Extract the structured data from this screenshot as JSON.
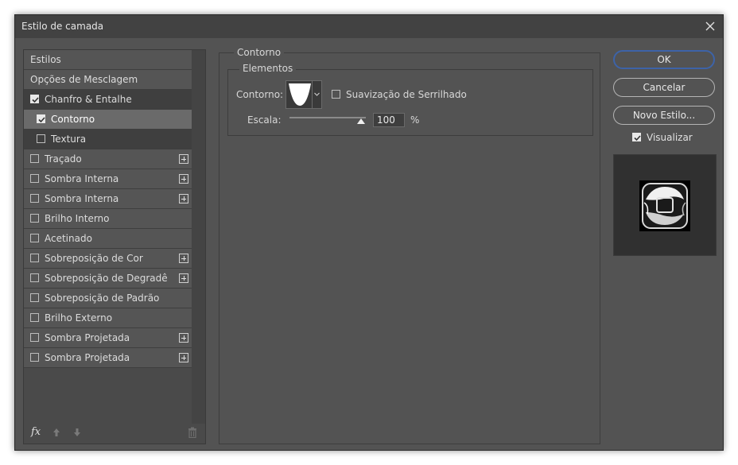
{
  "window": {
    "title": "Estilo de camada"
  },
  "sidebar": {
    "items": [
      {
        "label": "Estilos",
        "kind": "header"
      },
      {
        "label": "Opções de Mesclagem",
        "kind": "header"
      },
      {
        "label": "Chanfro & Entalhe",
        "checked": true
      },
      {
        "label": "Contorno",
        "checked": true,
        "sub": true,
        "selected": true
      },
      {
        "label": "Textura",
        "checked": false,
        "sub": true
      },
      {
        "label": "Traçado",
        "checked": false,
        "plus": true
      },
      {
        "label": "Sombra Interna",
        "checked": false,
        "plus": true
      },
      {
        "label": "Sombra Interna",
        "checked": false,
        "plus": true
      },
      {
        "label": "Brilho Interno",
        "checked": false
      },
      {
        "label": "Acetinado",
        "checked": false
      },
      {
        "label": "Sobreposição de Cor",
        "checked": false,
        "plus": true
      },
      {
        "label": "Sobreposição de Degradê",
        "checked": false,
        "plus": true
      },
      {
        "label": "Sobreposição de Padrão",
        "checked": false
      },
      {
        "label": "Brilho Externo",
        "checked": false
      },
      {
        "label": "Sombra Projetada",
        "checked": false,
        "plus": true
      },
      {
        "label": "Sombra Projetada",
        "checked": false,
        "plus": true
      }
    ],
    "footer": {
      "fx_label": "fx"
    }
  },
  "panel": {
    "section_title": "Contorno",
    "group_title": "Elementos",
    "contour_label": "Contorno:",
    "antialias_label": "Suavização de Serrilhado",
    "antialias_checked": false,
    "scale_label": "Escala:",
    "scale_value": "100",
    "scale_fraction": 1.0,
    "scale_unit": "%"
  },
  "buttons": {
    "ok": "OK",
    "cancel": "Cancelar",
    "new_style": "Novo Estilo..."
  },
  "preview": {
    "label": "Visualizar",
    "checked": true
  },
  "colors": {
    "accent": "#3d63a8",
    "dialog_bg": "#535353",
    "selected_row": "#6a6a6a"
  }
}
